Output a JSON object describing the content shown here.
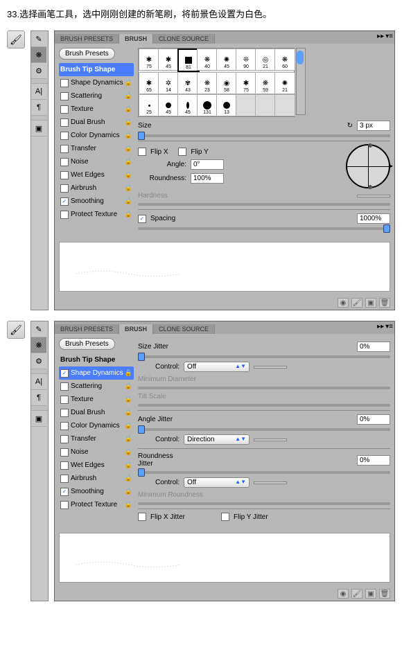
{
  "step_text": "33.选择画笔工具，选中刚刚创建的新笔刷，将前景色设置为白色。",
  "tabs": {
    "presets": "BRUSH PRESETS",
    "brush": "BRUSH",
    "clone": "CLONE SOURCE"
  },
  "presets_btn": "Brush Presets",
  "blist": {
    "tip": "Brush Tip Shape",
    "shape": "Shape Dynamics",
    "scatter": "Scattering",
    "texture": "Texture",
    "dual": "Dual Brush",
    "color": "Color Dynamics",
    "transfer": "Transfer",
    "noise": "Noise",
    "wet": "Wet Edges",
    "air": "Airbrush",
    "smooth": "Smoothing",
    "protect": "Protect Texture"
  },
  "brush_sizes_row1": [
    "75",
    "45",
    "81",
    "40",
    "45",
    "90",
    "21",
    "60"
  ],
  "brush_sizes_row2": [
    "65",
    "14",
    "43",
    "23",
    "58",
    "75",
    "59",
    "21"
  ],
  "brush_sizes_row3": [
    "25",
    "45",
    "45",
    "131",
    "13"
  ],
  "size": {
    "label": "Size",
    "value": "3 px"
  },
  "flipx": "Flip X",
  "flipy": "Flip Y",
  "angle": {
    "label": "Angle:",
    "value": "0°"
  },
  "roundness": {
    "label": "Roundness:",
    "value": "100%"
  },
  "hardness": {
    "label": "Hardness"
  },
  "spacing": {
    "label": "Spacing",
    "value": "1000%"
  },
  "sd": {
    "size_jitter": {
      "label": "Size Jitter",
      "value": "0%"
    },
    "control": "Control:",
    "off": "Off",
    "direction": "Direction",
    "min_diam": "Minimum Diameter",
    "tilt": "Tilt Scale",
    "angle_jitter": {
      "label": "Angle Jitter",
      "value": "0%"
    },
    "round_jitter": {
      "label": "Roundness Jitter",
      "value": "0%"
    },
    "min_round": "Minimum Roundness",
    "flipxj": "Flip X Jitter",
    "flipyj": "Flip Y Jitter"
  }
}
